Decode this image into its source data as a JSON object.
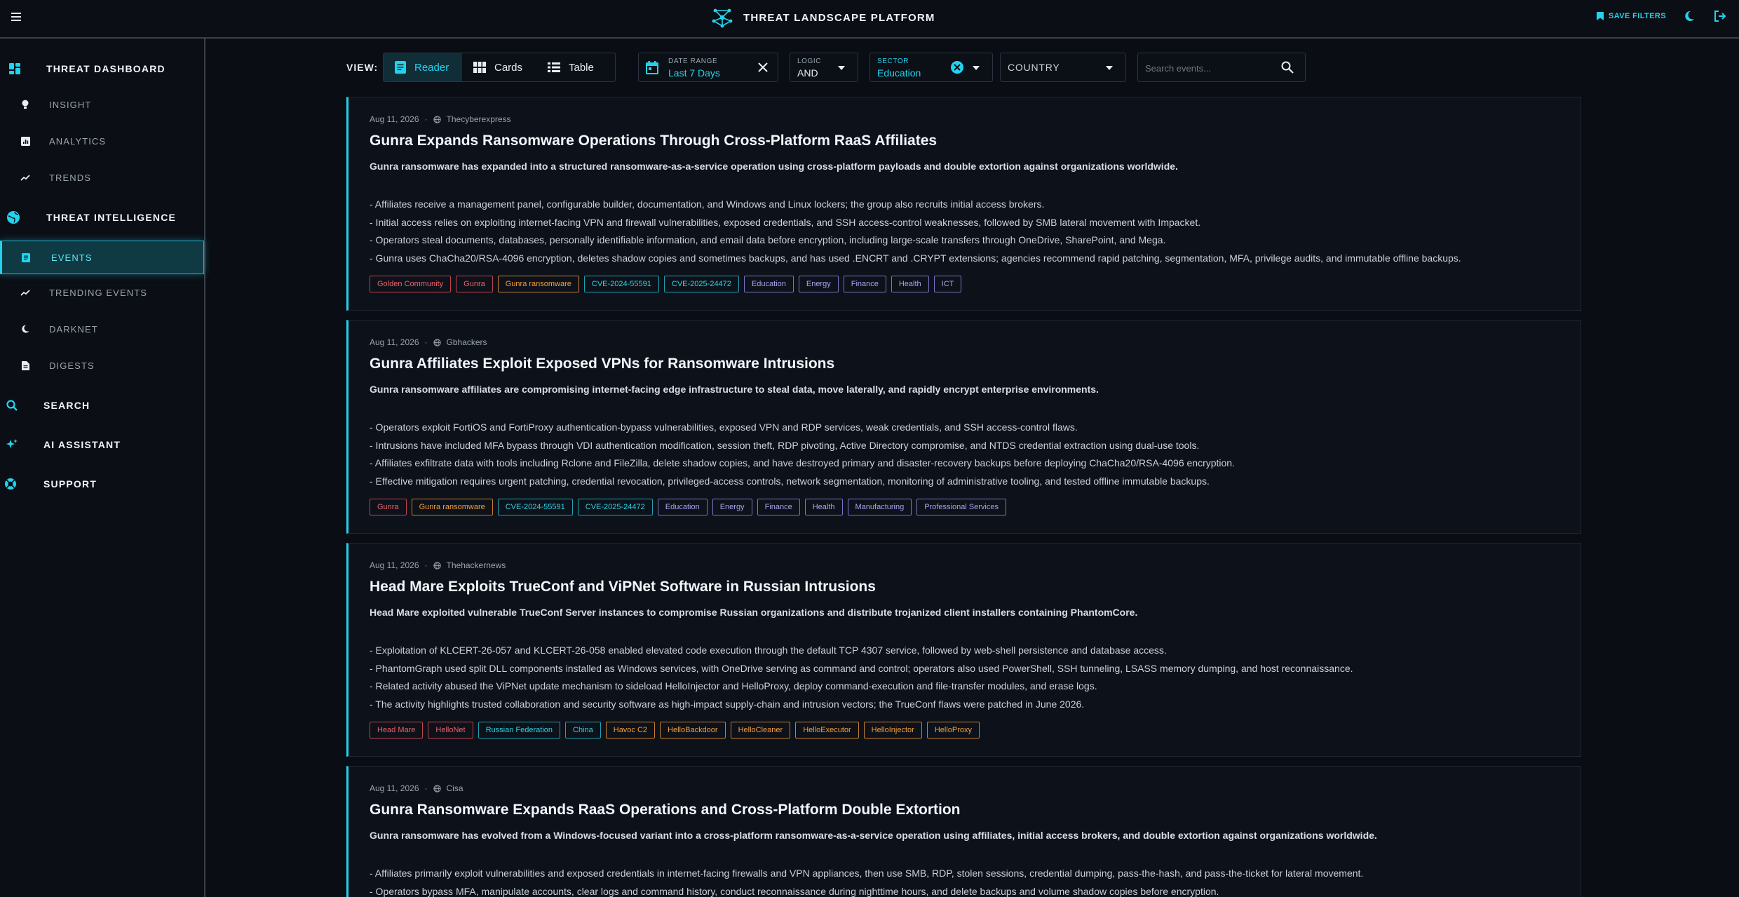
{
  "colors": {
    "accent": "#22d3ee",
    "background": "#0a0e14"
  },
  "header": {
    "title": "THREAT LANDSCAPE PLATFORM",
    "save_filters": "SAVE FILTERS"
  },
  "sidebar": {
    "groups": [
      {
        "label": "THREAT DASHBOARD",
        "icon": "dashboard-icon"
      },
      {
        "label": "THREAT INTELLIGENCE",
        "icon": "globe-icon"
      },
      {
        "label": "SEARCH",
        "icon": "search-icon"
      },
      {
        "label": "AI ASSISTANT",
        "icon": "sparkle-icon"
      },
      {
        "label": "SUPPORT",
        "icon": "lifebuoy-icon"
      }
    ],
    "items": [
      {
        "label": "INSIGHT",
        "icon": "lightbulb-icon"
      },
      {
        "label": "ANALYTICS",
        "icon": "chart-icon"
      },
      {
        "label": "TRENDS",
        "icon": "trend-icon"
      },
      {
        "label": "EVENTS",
        "icon": "events-icon",
        "active": true
      },
      {
        "label": "TRENDING EVENTS",
        "icon": "trend-icon"
      },
      {
        "label": "DARKNET",
        "icon": "moon-icon"
      },
      {
        "label": "DIGESTS",
        "icon": "document-icon"
      }
    ]
  },
  "filters": {
    "view_label": "VIEW:",
    "views": [
      "Reader",
      "Cards",
      "Table"
    ],
    "active_view": "Reader",
    "date_range": {
      "label": "DATE RANGE",
      "value": "Last 7 Days"
    },
    "logic": {
      "label": "LOGIC",
      "value": "AND"
    },
    "sector": {
      "label": "SECTOR",
      "value": "Education"
    },
    "country": {
      "label": "COUNTRY"
    },
    "search": {
      "placeholder": "Search events..."
    }
  },
  "events": [
    {
      "date": "Aug 11, 2026",
      "source": "Thecyberexpress",
      "title": "Gunra Expands Ransomware Operations Through Cross-Platform RaaS Affiliates",
      "summary": "Gunra ransomware has expanded into a structured ransomware-as-a-service operation using cross-platform payloads and double extortion against organizations worldwide.",
      "bullets": [
        "- Affiliates receive a management panel, configurable builder, documentation, and Windows and Linux lockers; the group also recruits initial access brokers.",
        "- Initial access relies on exploiting internet-facing VPN and firewall vulnerabilities, exposed credentials, and SSH access-control weaknesses, followed by SMB lateral movement with Impacket.",
        "- Operators steal documents, databases, personally identifiable information, and email data before encryption, including large-scale transfers through OneDrive, SharePoint, and Mega.",
        "- Gunra uses ChaCha20/RSA-4096 encryption, deletes shadow copies and sometimes backups, and has used .ENCRT and .CRYPT extensions; agencies recommend rapid patching, segmentation, MFA, privilege audits, and immutable offline backups."
      ],
      "tags": [
        {
          "label": "Golden Community",
          "color": "red"
        },
        {
          "label": "Gunra",
          "color": "red"
        },
        {
          "label": "Gunra ransomware",
          "color": "orange"
        },
        {
          "label": "CVE-2024-55591",
          "color": "teal"
        },
        {
          "label": "CVE-2025-24472",
          "color": "teal"
        },
        {
          "label": "Education",
          "color": "purple"
        },
        {
          "label": "Energy",
          "color": "purple"
        },
        {
          "label": "Finance",
          "color": "purple"
        },
        {
          "label": "Health",
          "color": "purple"
        },
        {
          "label": "ICT",
          "color": "purple"
        }
      ]
    },
    {
      "date": "Aug 11, 2026",
      "source": "Gbhackers",
      "title": "Gunra Affiliates Exploit Exposed VPNs for Ransomware Intrusions",
      "summary": "Gunra ransomware affiliates are compromising internet-facing edge infrastructure to steal data, move laterally, and rapidly encrypt enterprise environments.",
      "bullets": [
        "- Operators exploit FortiOS and FortiProxy authentication-bypass vulnerabilities, exposed VPN and RDP services, weak credentials, and SSH access-control flaws.",
        "- Intrusions have included MFA bypass through VDI authentication modification, session theft, RDP pivoting, Active Directory compromise, and NTDS credential extraction using dual-use tools.",
        "- Affiliates exfiltrate data with tools including Rclone and FileZilla, delete shadow copies, and have destroyed primary and disaster-recovery backups before deploying ChaCha20/RSA-4096 encryption.",
        "- Effective mitigation requires urgent patching, credential revocation, privileged-access controls, network segmentation, monitoring of administrative tooling, and tested offline immutable backups."
      ],
      "tags": [
        {
          "label": "Gunra",
          "color": "red"
        },
        {
          "label": "Gunra ransomware",
          "color": "orange"
        },
        {
          "label": "CVE-2024-55591",
          "color": "teal"
        },
        {
          "label": "CVE-2025-24472",
          "color": "teal"
        },
        {
          "label": "Education",
          "color": "purple"
        },
        {
          "label": "Energy",
          "color": "purple"
        },
        {
          "label": "Finance",
          "color": "purple"
        },
        {
          "label": "Health",
          "color": "purple"
        },
        {
          "label": "Manufacturing",
          "color": "purple"
        },
        {
          "label": "Professional Services",
          "color": "purple"
        }
      ]
    },
    {
      "date": "Aug 11, 2026",
      "source": "Thehackernews",
      "title": "Head Mare Exploits TrueConf and ViPNet Software in Russian Intrusions",
      "summary": "Head Mare exploited vulnerable TrueConf Server instances to compromise Russian organizations and distribute trojanized client installers containing PhantomCore.",
      "bullets": [
        "- Exploitation of KLCERT-26-057 and KLCERT-26-058 enabled elevated code execution through the default TCP 4307 service, followed by web-shell persistence and database access.",
        "- PhantomGraph used split DLL components installed as Windows services, with OneDrive serving as command and control; operators also used PowerShell, SSH tunneling, LSASS memory dumping, and host reconnaissance.",
        "- Related activity abused the ViPNet update mechanism to sideload HelloInjector and HelloProxy, deploy command-execution and file-transfer modules, and erase logs.",
        "- The activity highlights trusted collaboration and security software as high-impact supply-chain and intrusion vectors; the TrueConf flaws were patched in June 2026."
      ],
      "tags": [
        {
          "label": "Head Mare",
          "color": "red"
        },
        {
          "label": "HelloNet",
          "color": "red"
        },
        {
          "label": "Russian Federation",
          "color": "teal"
        },
        {
          "label": "China",
          "color": "teal"
        },
        {
          "label": "Havoc C2",
          "color": "orange"
        },
        {
          "label": "HelloBackdoor",
          "color": "orange"
        },
        {
          "label": "HelloCleaner",
          "color": "orange"
        },
        {
          "label": "HelloExecutor",
          "color": "orange"
        },
        {
          "label": "HelloInjector",
          "color": "orange"
        },
        {
          "label": "HelloProxy",
          "color": "orange"
        }
      ]
    },
    {
      "date": "Aug 11, 2026",
      "source": "Cisa",
      "title": "Gunra Ransomware Expands RaaS Operations and Cross-Platform Double Extortion",
      "summary": "Gunra ransomware has evolved from a Windows-focused variant into a cross-platform ransomware-as-a-service operation using affiliates, initial access brokers, and double extortion against organizations worldwide.",
      "bullets": [
        "- Affiliates primarily exploit vulnerabilities and exposed credentials in internet-facing firewalls and VPN appliances, then use SMB, RDP, stolen sessions, credential dumping, pass-the-hash, and pass-the-ticket for lateral movement.",
        "- Operators bypass MFA, manipulate accounts, clear logs and command history, conduct reconnaissance during nighttime hours, and delete backups and volume shadow copies before encryption."
      ],
      "tags": []
    }
  ]
}
